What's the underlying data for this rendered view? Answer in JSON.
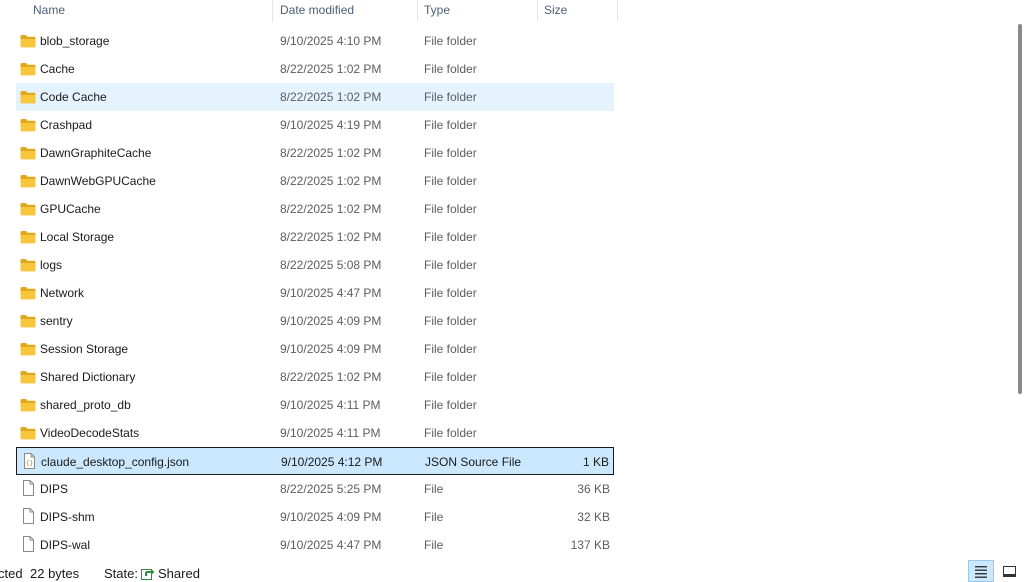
{
  "columns": {
    "name": "Name",
    "date_modified": "Date modified",
    "type": "Type",
    "size": "Size"
  },
  "files": [
    {
      "name": "blob_storage",
      "date": "9/10/2025 4:10 PM",
      "type": "File folder",
      "size": "",
      "icon": "folder-icon"
    },
    {
      "name": "Cache",
      "date": "8/22/2025 1:02 PM",
      "type": "File folder",
      "size": "",
      "icon": "folder-icon"
    },
    {
      "name": "Code Cache",
      "date": "8/22/2025 1:02 PM",
      "type": "File folder",
      "size": "",
      "icon": "folder-icon"
    },
    {
      "name": "Crashpad",
      "date": "9/10/2025 4:19 PM",
      "type": "File folder",
      "size": "",
      "icon": "folder-icon"
    },
    {
      "name": "DawnGraphiteCache",
      "date": "8/22/2025 1:02 PM",
      "type": "File folder",
      "size": "",
      "icon": "folder-icon"
    },
    {
      "name": "DawnWebGPUCache",
      "date": "8/22/2025 1:02 PM",
      "type": "File folder",
      "size": "",
      "icon": "folder-icon"
    },
    {
      "name": "GPUCache",
      "date": "8/22/2025 1:02 PM",
      "type": "File folder",
      "size": "",
      "icon": "folder-icon"
    },
    {
      "name": "Local Storage",
      "date": "8/22/2025 1:02 PM",
      "type": "File folder",
      "size": "",
      "icon": "folder-icon"
    },
    {
      "name": "logs",
      "date": "8/22/2025 5:08 PM",
      "type": "File folder",
      "size": "",
      "icon": "folder-icon"
    },
    {
      "name": "Network",
      "date": "9/10/2025 4:47 PM",
      "type": "File folder",
      "size": "",
      "icon": "folder-icon"
    },
    {
      "name": "sentry",
      "date": "9/10/2025 4:09 PM",
      "type": "File folder",
      "size": "",
      "icon": "folder-icon"
    },
    {
      "name": "Session Storage",
      "date": "9/10/2025 4:09 PM",
      "type": "File folder",
      "size": "",
      "icon": "folder-icon"
    },
    {
      "name": "Shared Dictionary",
      "date": "8/22/2025 1:02 PM",
      "type": "File folder",
      "size": "",
      "icon": "folder-icon"
    },
    {
      "name": "shared_proto_db",
      "date": "9/10/2025 4:11 PM",
      "type": "File folder",
      "size": "",
      "icon": "folder-icon"
    },
    {
      "name": "VideoDecodeStats",
      "date": "9/10/2025 4:11 PM",
      "type": "File folder",
      "size": "",
      "icon": "folder-icon"
    },
    {
      "name": "claude_desktop_config.json",
      "date": "9/10/2025 4:12 PM",
      "type": "JSON Source File",
      "size": "1 KB",
      "icon": "json-file-icon"
    },
    {
      "name": "DIPS",
      "date": "8/22/2025 5:25 PM",
      "type": "File",
      "size": "36 KB",
      "icon": "file-icon"
    },
    {
      "name": "DIPS-shm",
      "date": "9/10/2025 4:09 PM",
      "type": "File",
      "size": "32 KB",
      "icon": "file-icon"
    },
    {
      "name": "DIPS-wal",
      "date": "9/10/2025 4:47 PM",
      "type": "File",
      "size": "137 KB",
      "icon": "file-icon"
    }
  ],
  "hover_index": 2,
  "selected_index": 15,
  "status": {
    "selected_text": "cted",
    "bytes_text": "22 bytes",
    "state_label": "State:",
    "state_value": "Shared"
  },
  "colors": {
    "folder": "#f8c83c",
    "folder_dark": "#e0a81e",
    "hover_bg": "#e5f3ff",
    "selected_bg": "#cce8ff",
    "share_green": "#2e8b3e"
  }
}
